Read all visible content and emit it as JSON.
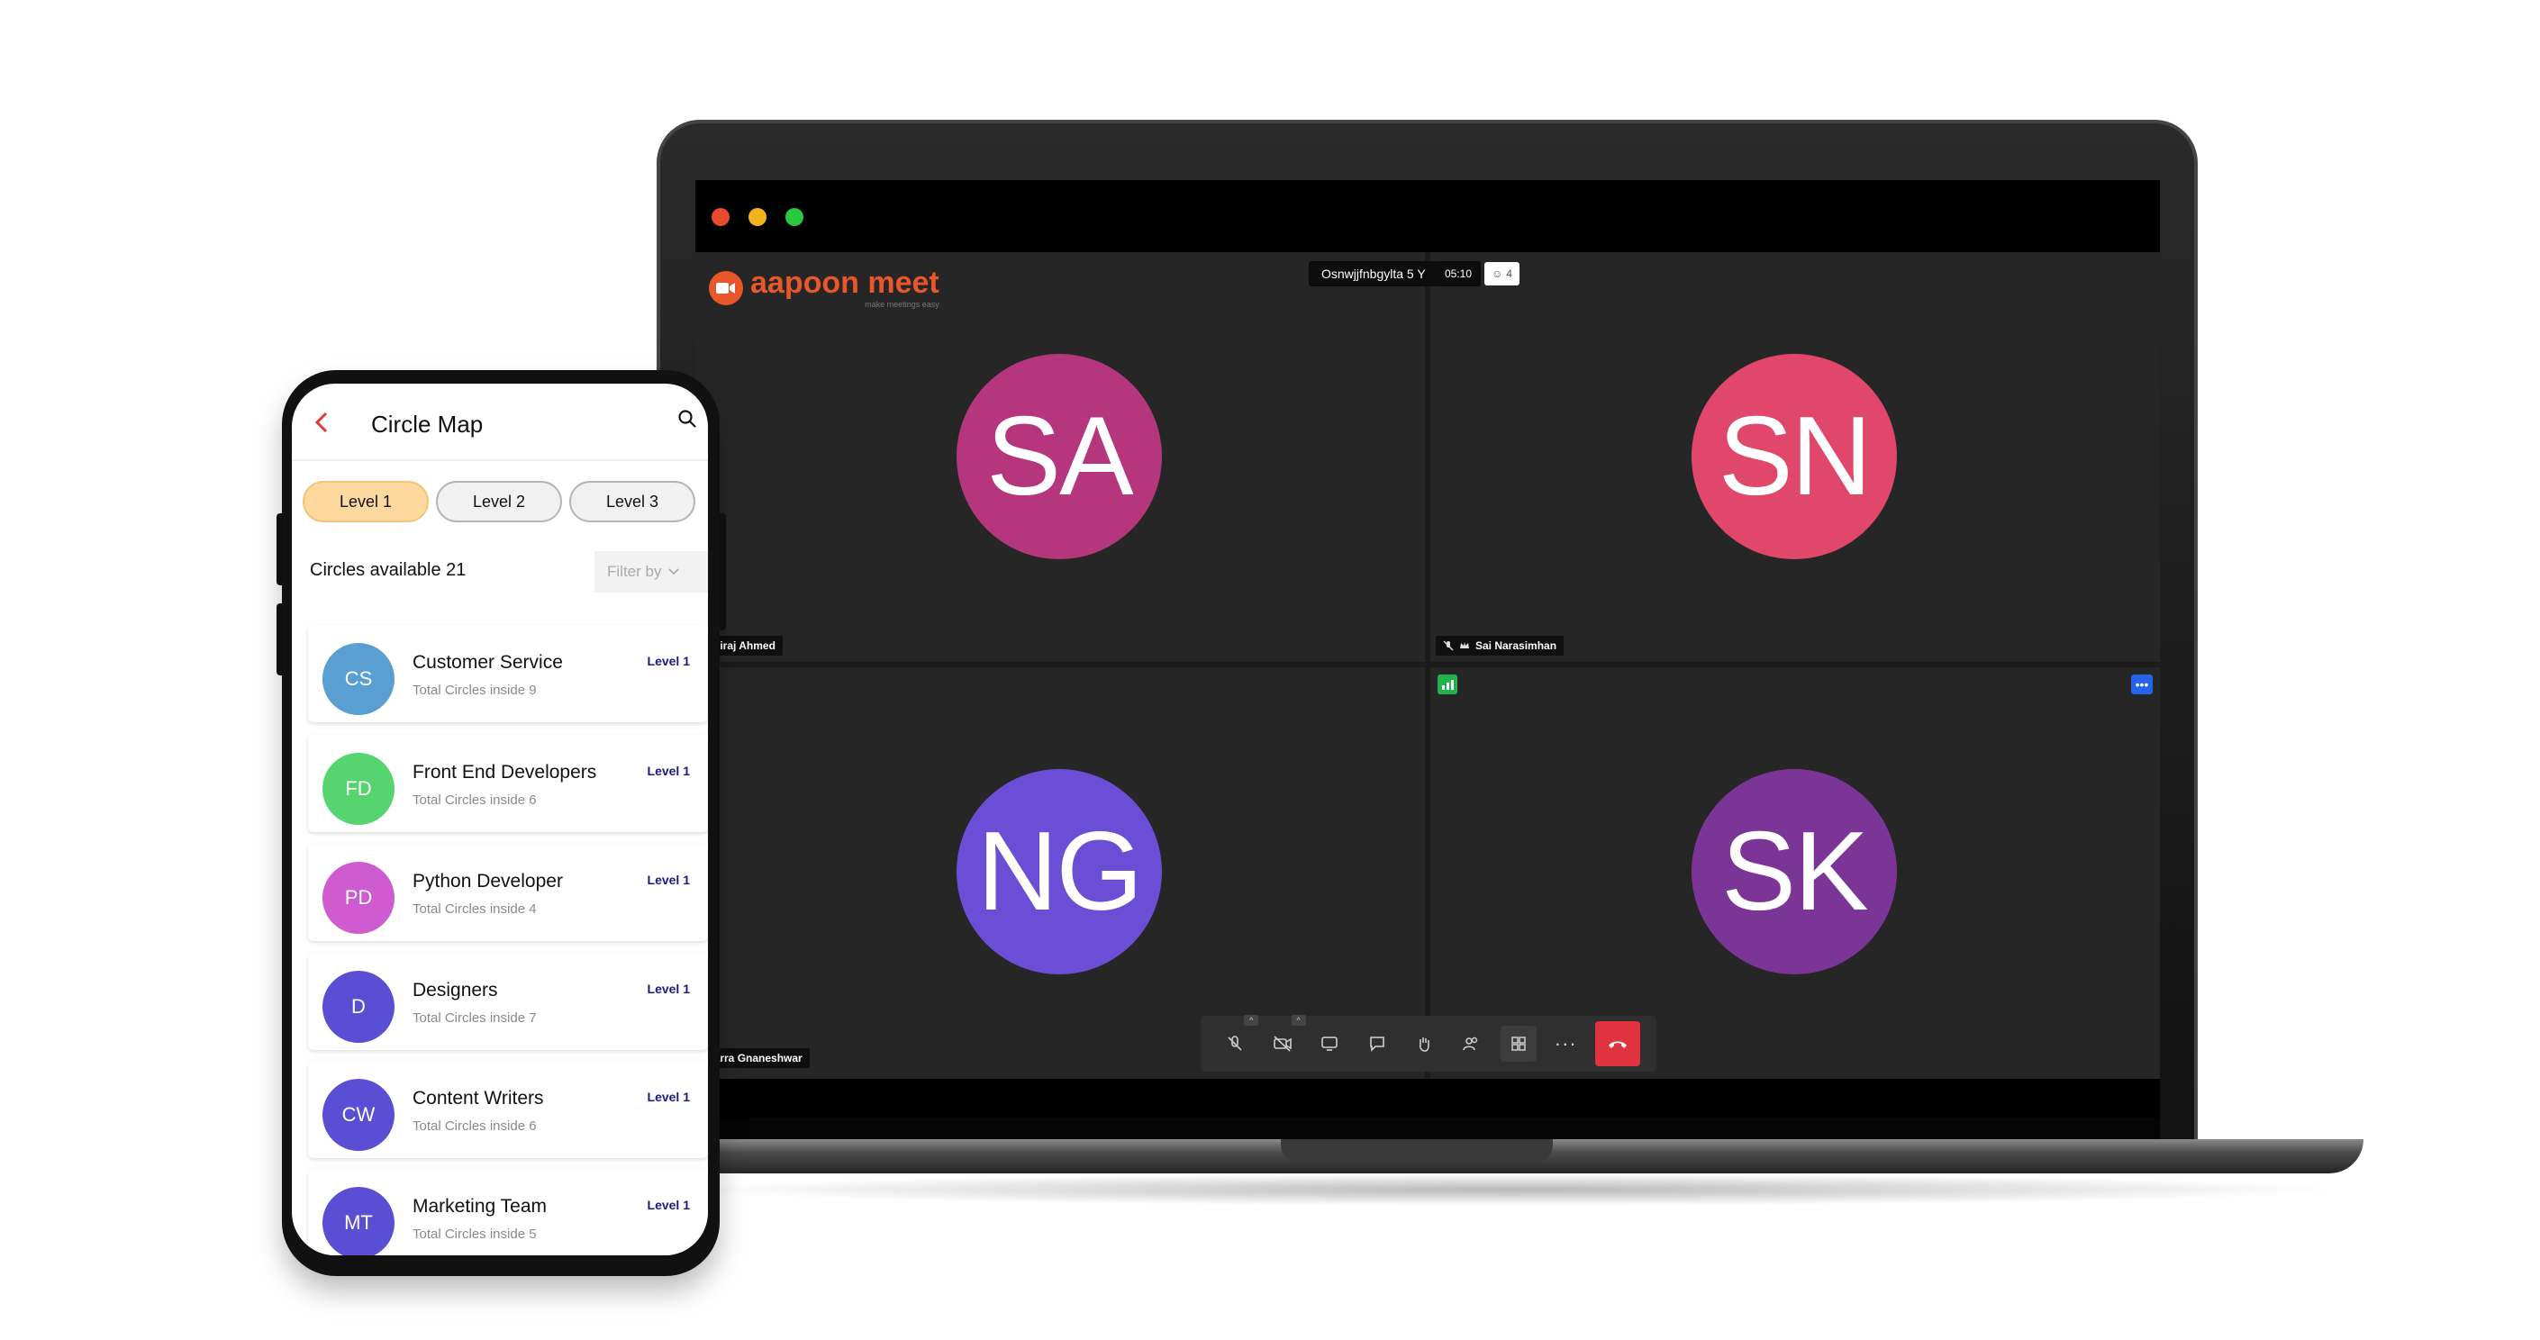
{
  "meet": {
    "app_name": "aapoon meet",
    "tagline": "make meetings easy",
    "meeting_title": "Osnwjjfnbgylta 5 Y",
    "timer": "05:10",
    "participant_count": "4",
    "participants": [
      {
        "initials": "SA",
        "name": "Shiraj Ahmed",
        "color": "#b5367c"
      },
      {
        "initials": "SN",
        "name": "Sai Narasimhan",
        "color": "#e0476a"
      },
      {
        "initials": "NG",
        "name": "Narra Gnaneshwar",
        "color": "#6a4fd6"
      },
      {
        "initials": "SK",
        "name": "",
        "color": "#7b3597"
      }
    ],
    "toolbar": {
      "icons": [
        "mic-off-icon",
        "camera-off-icon",
        "screen-share-icon",
        "chat-icon",
        "raise-hand-icon",
        "participants-icon",
        "grid-view-icon",
        "more-icon",
        "end-call-icon"
      ],
      "more_label": "···"
    },
    "window_dots": {
      "close": "#e84a2e",
      "minimize": "#f3b21b",
      "maximize": "#28c840"
    }
  },
  "phone": {
    "title": "Circle Map",
    "tabs": [
      {
        "label": "Level 1",
        "active": true
      },
      {
        "label": "Level 2",
        "active": false
      },
      {
        "label": "Level 3",
        "active": false
      }
    ],
    "circles_available": "Circles available 21",
    "filter_label": "Filter by",
    "circles": [
      {
        "initials": "CS",
        "name": "Customer Service",
        "sub": "Total Circles inside 9",
        "level": "Level 1",
        "color": "#5a9fd1"
      },
      {
        "initials": "FD",
        "name": "Front End Developers",
        "sub": "Total Circles inside 6",
        "level": "Level 1",
        "color": "#55d46f"
      },
      {
        "initials": "PD",
        "name": "Python Developer",
        "sub": "Total Circles inside 4",
        "level": "Level 1",
        "color": "#cf5bd1"
      },
      {
        "initials": "D",
        "name": "Designers",
        "sub": "Total Circles inside 7",
        "level": "Level 1",
        "color": "#5a4fd4"
      },
      {
        "initials": "CW",
        "name": "Content Writers",
        "sub": "Total Circles inside 6",
        "level": "Level 1",
        "color": "#5a4fd4"
      },
      {
        "initials": "MT",
        "name": "Marketing Team",
        "sub": "Total Circles inside 5",
        "level": "Level 1",
        "color": "#5a4fd4"
      }
    ]
  }
}
